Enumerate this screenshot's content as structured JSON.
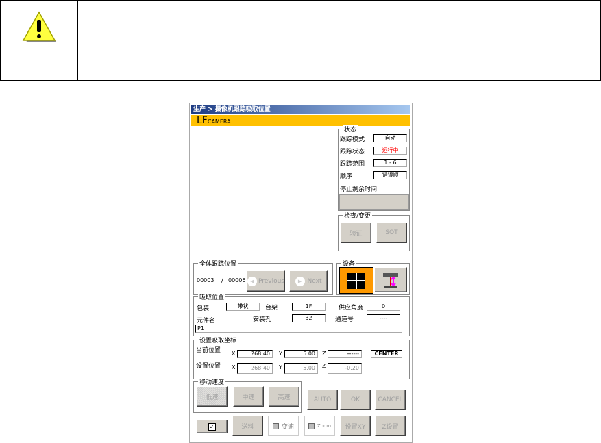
{
  "title": "生产 > 摄像机跟踪吸取位置",
  "camera": {
    "main": "LF",
    "sub": "CAMERA"
  },
  "status": {
    "legend": "状态",
    "rows": [
      {
        "label": "跟踪模式",
        "value": "自动"
      },
      {
        "label": "跟踪状态",
        "value": "运行中"
      },
      {
        "label": "跟踪范围",
        "value": "1 - 6"
      },
      {
        "label": "顺序",
        "value": "错误顺"
      }
    ],
    "remaining_label": "停止剩余时间",
    "remaining_value": "",
    "running_color": "#ff0000"
  },
  "check": {
    "legend": "检查/变更",
    "verify": "验证",
    "sot": "SOT"
  },
  "tracking": {
    "legend": "全体跟踪位置",
    "current": "00003",
    "sep": "/",
    "total": "00006",
    "previous": "Previous",
    "next": "Next"
  },
  "device": {
    "legend": "设备"
  },
  "pickup": {
    "legend": "吸取位置",
    "package_label": "包装",
    "package": "带状",
    "rack_label": "台架",
    "rack": "1F",
    "angle_label": "供应角度",
    "angle": "0",
    "part_label": "元件名",
    "hole_label": "安装孔",
    "hole": "32",
    "channel_label": "通道号",
    "channel": "----",
    "part": "P1"
  },
  "coords": {
    "legend": "设置吸取坐标",
    "current_label": "当前位置",
    "set_label": "设置位置",
    "x": "X",
    "y": "Y",
    "z": "Z",
    "cur_x": "268.40",
    "cur_y": "5.00",
    "cur_z": "------",
    "center": "CENTER",
    "set_x": "268.40",
    "set_y": "5.00",
    "set_z": "-0.20"
  },
  "speed": {
    "legend": "移动速度",
    "low": "低速",
    "mid": "中速",
    "high": "高速"
  },
  "actions": {
    "auto": "AUTO",
    "ok": "OK",
    "cancel": "CANCEL",
    "feed": "送料",
    "varspeed": "变速",
    "zoom": "Zoom",
    "setxy": "设置XY",
    "zset": "Z设置"
  }
}
